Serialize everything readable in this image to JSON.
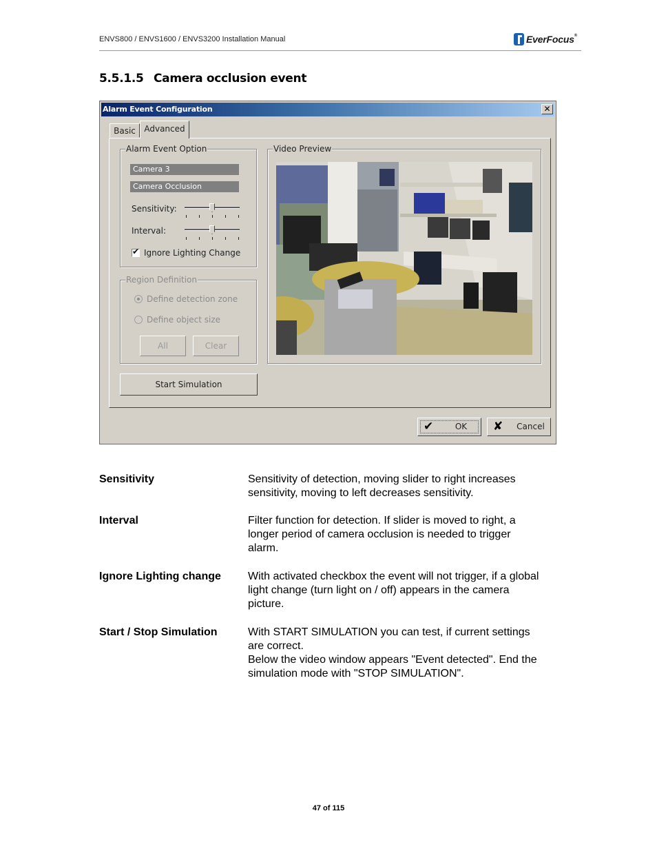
{
  "page": {
    "header": "ENVS800 / ENVS1600 / ENVS3200 Installation Manual",
    "logo": {
      "text": "EverFocus",
      "registered": "®",
      "brand_color": "#1a62b0"
    },
    "section_number": "5.5.1.5",
    "section_title": "Camera occlusion event",
    "footer": "47 of 115"
  },
  "dialog": {
    "title": "Alarm Event Configuration",
    "close_glyph": "✕",
    "titlebar_colors": [
      "#0a246a",
      "#a6caf0"
    ],
    "tabs": [
      {
        "label": "Basic",
        "active": false
      },
      {
        "label": "Advanced",
        "active": true
      }
    ],
    "alarm_event_option": {
      "label": "Alarm Event Option",
      "camera": "Camera 3",
      "event_type": "Camera Occlusion",
      "sensitivity": {
        "label": "Sensitivity:",
        "position": 0.5,
        "ticks": 5
      },
      "interval": {
        "label": "Interval:",
        "position": 0.5,
        "ticks": 5
      },
      "ignore_lighting": {
        "label": "Ignore Lighting Change",
        "checked": true,
        "mark": "✔"
      }
    },
    "region_definition": {
      "label": "Region Definition",
      "disabled": true,
      "options": [
        {
          "label": "Define detection zone",
          "selected": true
        },
        {
          "label": "Define object size",
          "selected": false
        }
      ],
      "all_button": "All",
      "clear_button": "Clear"
    },
    "video_preview": {
      "label": "Video Preview",
      "content": "office camera feed"
    },
    "start_simulation": "Start Simulation",
    "ok_button": {
      "label": "OK",
      "icon": "✔"
    },
    "cancel_button": {
      "label": "Cancel",
      "icon": "✘"
    }
  },
  "definitions": [
    {
      "term": "Sensitivity",
      "lines": [
        "Sensitivity of detection, moving slider to right increases",
        "sensitivity, moving to left decreases sensitivity."
      ]
    },
    {
      "term": "Interval",
      "lines": [
        "Filter function for detection.  If slider is moved to right, a",
        "longer period of camera occlusion  is needed to trigger",
        "alarm."
      ]
    },
    {
      "term": "Ignore Lighting change",
      "lines": [
        "With activated checkbox the event will not trigger, if a global",
        "light change (turn light on / off) appears in the camera",
        "picture."
      ]
    },
    {
      "term": "Start / Stop Simulation",
      "lines": [
        "With START SIMULATION you can test, if current settings",
        "are correct.",
        "Below the video window appears \"Event detected\". End the",
        "simulation mode with \"STOP SIMULATION\"."
      ]
    }
  ]
}
